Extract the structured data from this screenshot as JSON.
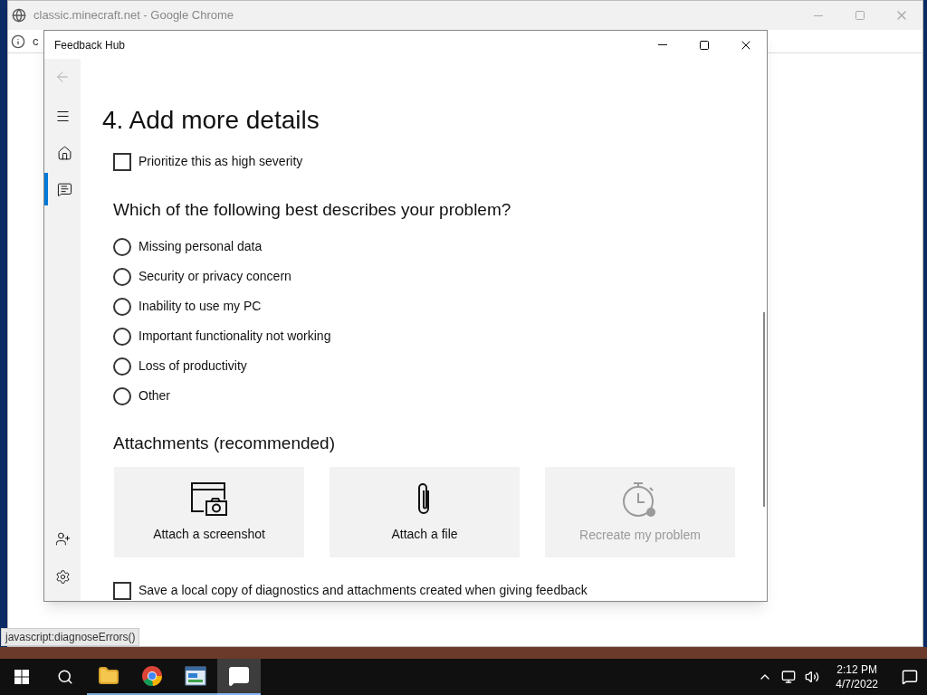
{
  "browser": {
    "title": "classic.minecraft.net - Google Chrome",
    "address": "c",
    "status_text": "javascript:diagnoseErrors()"
  },
  "feedback_window": {
    "title": "Feedback Hub",
    "nav": [
      {
        "kind": "home",
        "selected": false
      },
      {
        "kind": "feedback",
        "selected": true
      }
    ],
    "heading": "4. Add more details",
    "severity_checkbox": {
      "label": "Prioritize this as high severity",
      "checked": false
    },
    "question": "Which of the following best describes your problem?",
    "options": [
      {
        "label": "Missing personal data",
        "selected": false
      },
      {
        "label": "Security or privacy concern",
        "selected": false
      },
      {
        "label": "Inability to use my PC",
        "selected": false
      },
      {
        "label": "Important functionality not working",
        "selected": false
      },
      {
        "label": "Loss of productivity",
        "selected": false
      },
      {
        "label": "Other",
        "selected": false
      }
    ],
    "attachments_heading": "Attachments (recommended)",
    "attachments": [
      {
        "kind": "screenshot",
        "label": "Attach a screenshot",
        "disabled": false
      },
      {
        "kind": "file",
        "label": "Attach a file",
        "disabled": false
      },
      {
        "kind": "recreate",
        "label": "Recreate my problem",
        "disabled": true
      }
    ],
    "save_checkbox": {
      "label": "Save a local copy of diagnostics and attachments created when giving feedback",
      "checked": false
    }
  },
  "taskbar": {
    "apps": [
      {
        "kind": "explorer",
        "active": false
      },
      {
        "kind": "chrome",
        "active": false
      },
      {
        "kind": "app",
        "active": false
      },
      {
        "kind": "feedback",
        "active": true
      }
    ],
    "time": "2:12 PM",
    "date": "4/7/2022"
  }
}
